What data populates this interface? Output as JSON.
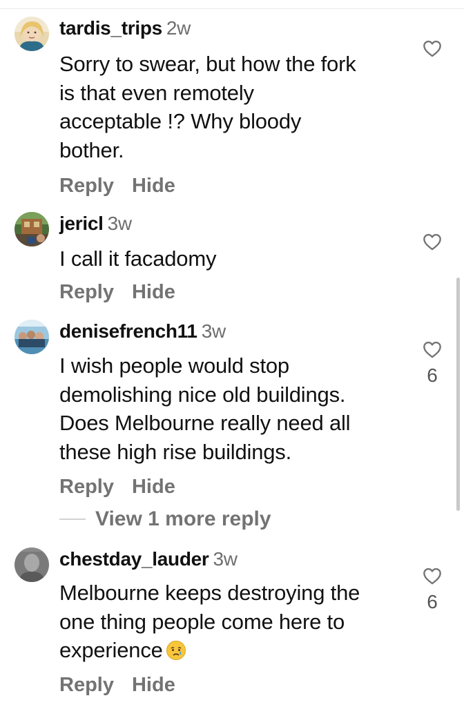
{
  "comments": [
    {
      "username": "tardis_trips",
      "age": "2w",
      "lines": [
        "Sorry to swear, but how the fork",
        "is that even remotely",
        "acceptable !? Why bloody",
        "bother."
      ],
      "reply_label": "Reply",
      "hide_label": "Hide",
      "likes": ""
    },
    {
      "username": "jericl",
      "age": "3w",
      "lines": [
        "I call it facadomy"
      ],
      "reply_label": "Reply",
      "hide_label": "Hide",
      "likes": ""
    },
    {
      "username": "denisefrench11",
      "age": "3w",
      "lines": [
        "I wish people would stop",
        "demolishing nice old buildings.",
        "Does Melbourne really need all",
        "these high rise buildings."
      ],
      "reply_label": "Reply",
      "hide_label": "Hide",
      "likes": "6"
    },
    {
      "username": "chestday_lauder",
      "age": "3w",
      "lines": [
        "Melbourne keeps destroying the",
        "one thing people come here to",
        "experience"
      ],
      "reply_label": "Reply",
      "hide_label": "Hide",
      "likes": "6"
    }
  ],
  "view_more": "View 1 more reply",
  "icons": {
    "like": "heart-icon",
    "emoji": "crying-face-emoji"
  },
  "colors": {
    "text": "#111111",
    "secondary": "#737373",
    "separator": "#d2d2d2"
  }
}
